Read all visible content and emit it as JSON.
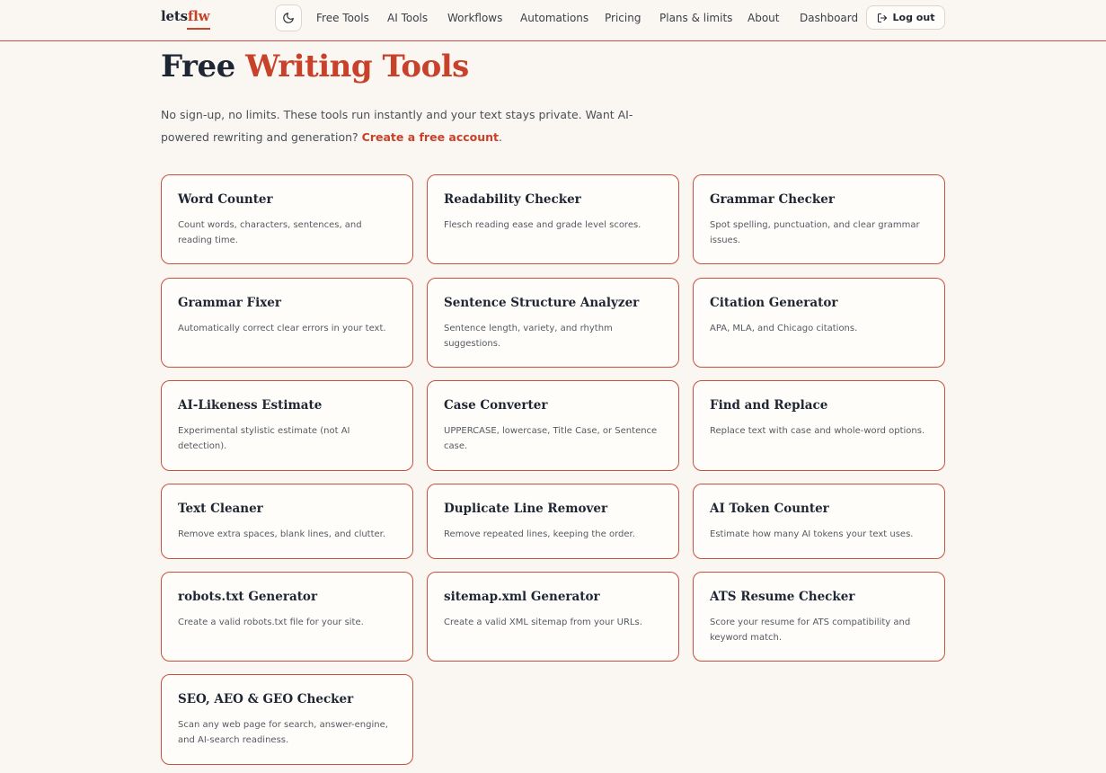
{
  "nav": {
    "logo_prefix": "lets",
    "logo_accent": "flw",
    "theme_toggle_icon": "moon-icon",
    "links": [
      "Free Tools",
      "AI Tools",
      "Workflows",
      "Automations",
      "Pricing",
      "Plans & limits",
      "About",
      "Dashboard"
    ],
    "logout_label": "Log out",
    "logout_icon": "logout-icon"
  },
  "hero": {
    "title_plain": "Free",
    "title_accent": "Writing Tools",
    "intro_text": "No sign-up, no limits. These tools run instantly and your text stays private. Want AI-powered rewriting and generation?",
    "intro_link": "Create a free account",
    "intro_end": "."
  },
  "tools": [
    {
      "title": "Word Counter",
      "desc": "Count words, characters, sentences, and reading time."
    },
    {
      "title": "Readability Checker",
      "desc": "Flesch reading ease and grade level scores."
    },
    {
      "title": "Grammar Checker",
      "desc": "Spot spelling, punctuation, and clear grammar issues."
    },
    {
      "title": "Grammar Fixer",
      "desc": "Automatically correct clear errors in your text."
    },
    {
      "title": "Sentence Structure Analyzer",
      "desc": "Sentence length, variety, and rhythm suggestions."
    },
    {
      "title": "Citation Generator",
      "desc": "APA, MLA, and Chicago citations."
    },
    {
      "title": "AI-Likeness Estimate",
      "desc": "Experimental stylistic estimate (not AI detection)."
    },
    {
      "title": "Case Converter",
      "desc": "UPPERCASE, lowercase, Title Case, or Sentence case."
    },
    {
      "title": "Find and Replace",
      "desc": "Replace text with case and whole-word options."
    },
    {
      "title": "Text Cleaner",
      "desc": "Remove extra spaces, blank lines, and clutter."
    },
    {
      "title": "Duplicate Line Remover",
      "desc": "Remove repeated lines, keeping the order."
    },
    {
      "title": "AI Token Counter",
      "desc": "Estimate how many AI tokens your text uses."
    },
    {
      "title": "robots.txt Generator",
      "desc": "Create a valid robots.txt file for your site."
    },
    {
      "title": "sitemap.xml Generator",
      "desc": "Create a valid XML sitemap from your URLs."
    },
    {
      "title": "ATS Resume Checker",
      "desc": "Score your resume for ATS compatibility and keyword match."
    },
    {
      "title": "SEO, AEO & GEO Checker",
      "desc": "Scan any web page for search, answer-engine, and AI-search readiness."
    }
  ],
  "colors": {
    "accent": "#c8412b",
    "background": "#faf7f2",
    "text": "#1f2633"
  }
}
